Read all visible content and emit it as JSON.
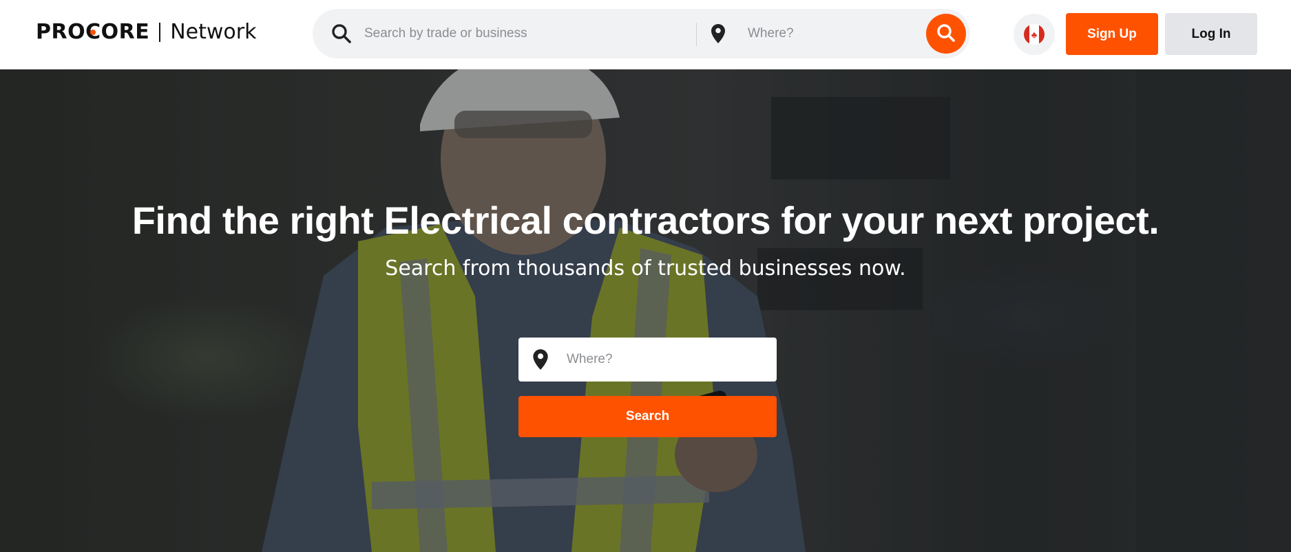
{
  "brand": {
    "logo_text": "PROCORE",
    "product": "Network",
    "accent_color": "#ff5200"
  },
  "header": {
    "search_placeholder": "Search by trade or business",
    "search_icon": "search-icon",
    "location_placeholder": "Where?",
    "location_icon": "location-pin-icon",
    "submit_icon": "search-icon",
    "region_flag": "canada-flag-icon",
    "signup_label": "Sign Up",
    "login_label": "Log In"
  },
  "hero": {
    "title": "Find the right Electrical contractors for your next project.",
    "subtitle": "Search from thousands of trusted businesses now.",
    "location_placeholder": "Where?",
    "location_icon": "location-pin-icon",
    "search_label": "Search"
  }
}
